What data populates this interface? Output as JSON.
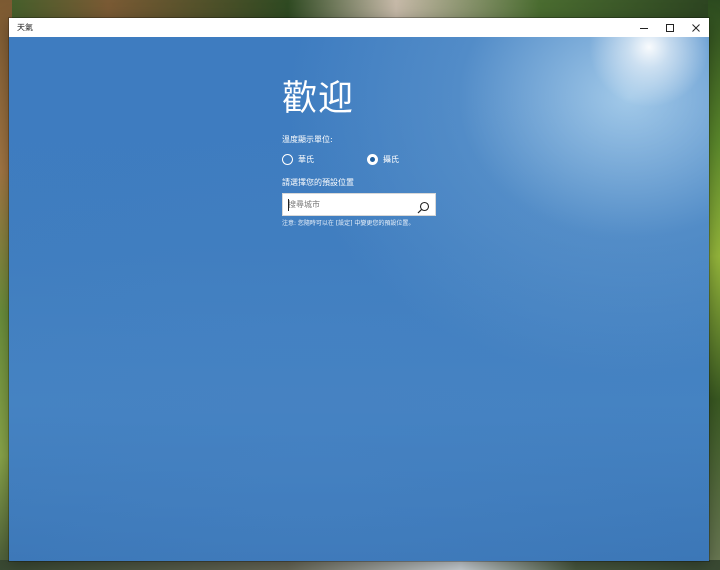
{
  "window": {
    "title": "天氣",
    "controls": [
      "minimize-icon",
      "maximize-icon",
      "close-icon"
    ]
  },
  "welcome": {
    "heading": "歡迎",
    "unit_label": "溫度顯示單位:",
    "units": [
      {
        "label": "華氏",
        "checked": false
      },
      {
        "label": "攝氏",
        "checked": true
      }
    ],
    "location_label": "請選擇您的預設位置",
    "search": {
      "value": "",
      "placeholder": "搜尋城市",
      "icon": "search-icon"
    },
    "note": "注意: 您隨時可以在 [設定] 中變更您的預設位置。"
  },
  "colors": {
    "sky_blue": "#3e7cc0",
    "accent": "#1e5e9e"
  }
}
